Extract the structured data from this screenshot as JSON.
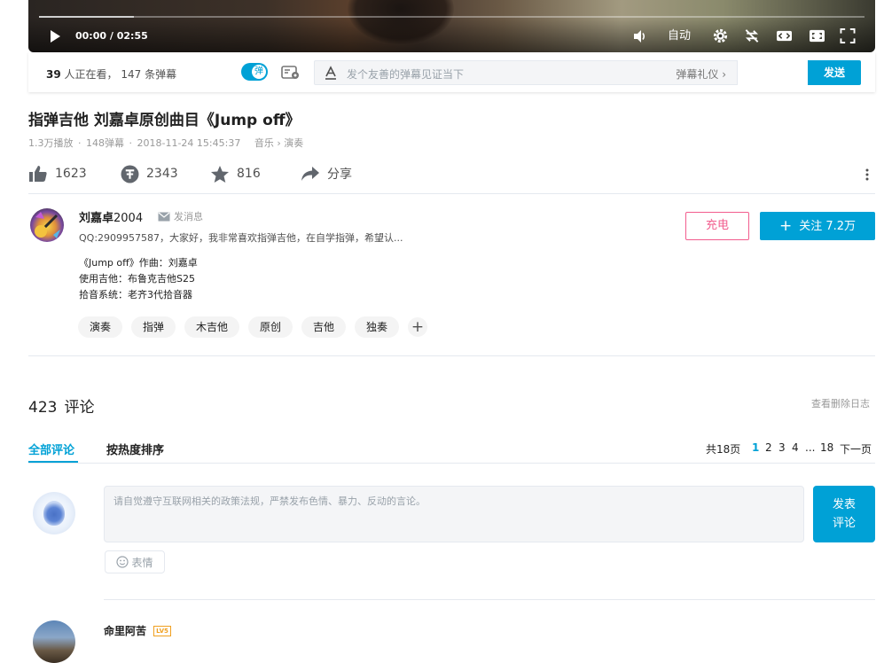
{
  "player": {
    "time_current": "00:00",
    "time_total": "02:55",
    "time_sep": "/",
    "quality": "自动",
    "progress": 0.115
  },
  "danmaku_bar": {
    "viewers": "39",
    "viewers_label": "人正在看，",
    "danmaku_count": "147",
    "danmaku_label": "条弹幕",
    "toggle_label": "弹",
    "input_placeholder": "发个友善的弹幕见证当下",
    "etiquette_label": "弹幕礼仪",
    "send_label": "发送"
  },
  "video": {
    "title": "指弹吉他 刘嘉卓原创曲目《Jump off》",
    "views": "1.3万播放",
    "danmaku": "148弹幕",
    "date": "2018-11-24 15:45:37",
    "zone_parent": "音乐",
    "zone_child": "演奏",
    "meta_sep": "·"
  },
  "actions": {
    "like": "1623",
    "coin": "2343",
    "favorite": "816",
    "share": "分享"
  },
  "uploader": {
    "name_bold": "刘嘉卓",
    "name_suffix": "2004",
    "message_label": "发消息",
    "description": "QQ:2909957587，大家好，我非常喜欢指弹吉他，在自学指弹，希望认...",
    "charge_label": "充电",
    "follow_label": "关注 7.2万"
  },
  "description_lines": [
    "《Jump off》作曲：刘嘉卓",
    "使用吉他：布鲁克吉他S25",
    "拾音系统：老齐3代拾音器"
  ],
  "tags": [
    "演奏",
    "指弹",
    "木吉他",
    "原创",
    "吉他",
    "独奏"
  ],
  "comments": {
    "count": "423",
    "count_label": "评论",
    "delete_log": "查看删除日志",
    "tab_all": "全部评论",
    "tab_hot": "按热度排序",
    "pager": {
      "total_pages": "共18页",
      "pages": [
        "1",
        "2",
        "3",
        "4"
      ],
      "ellipsis": "...",
      "last": "18",
      "next": "下一页"
    },
    "input_placeholder": "请自觉遵守互联网相关的政策法规，严禁发布色情、暴力、反动的言论。",
    "submit_line1": "发表",
    "submit_line2": "评论",
    "emoji_label": "表情",
    "first_user": "命里阿苦",
    "first_user_level": "LV5"
  },
  "colors": {
    "accent": "#00a1d6",
    "charge": "#f25d8e",
    "level": "#f0a020"
  }
}
